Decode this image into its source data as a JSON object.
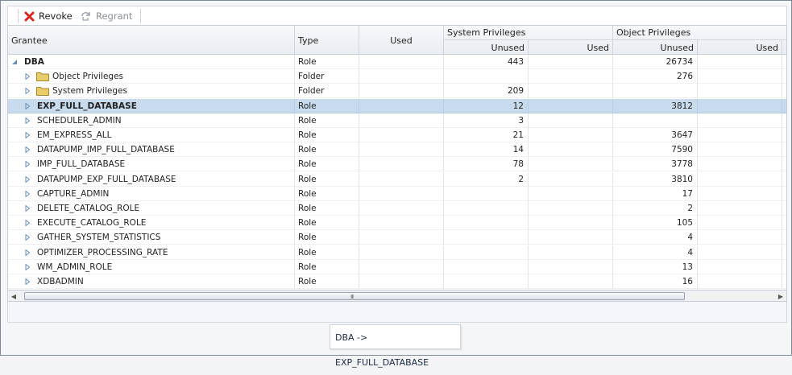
{
  "toolbar": {
    "revoke_label": "Revoke",
    "regrant_label": "Regrant"
  },
  "columns": {
    "grantee": "Grantee",
    "type": "Type",
    "used": "Used",
    "system_privileges": "System Privileges",
    "object_privileges": "Object Privileges",
    "sys_unused": "Unused",
    "sys_used": "Used",
    "obj_unused": "Unused",
    "obj_used": "Used"
  },
  "rows": [
    {
      "grantee": "DBA",
      "type": "Role",
      "used": "",
      "sys_unused": "443",
      "sys_used": "",
      "obj_unused": "26734",
      "obj_used": "",
      "level": 0,
      "expanded": true,
      "bold": true
    },
    {
      "grantee": "Object Privileges",
      "type": "Folder",
      "used": "",
      "sys_unused": "",
      "sys_used": "",
      "obj_unused": "276",
      "obj_used": "",
      "level": 1,
      "folder": true
    },
    {
      "grantee": "System Privileges",
      "type": "Folder",
      "used": "",
      "sys_unused": "209",
      "sys_used": "",
      "obj_unused": "",
      "obj_used": "",
      "level": 1,
      "folder": true
    },
    {
      "grantee": "EXP_FULL_DATABASE",
      "type": "Role",
      "used": "",
      "sys_unused": "12",
      "sys_used": "",
      "obj_unused": "3812",
      "obj_used": "",
      "level": 1,
      "selected": true,
      "bold": true
    },
    {
      "grantee": "SCHEDULER_ADMIN",
      "type": "Role",
      "used": "",
      "sys_unused": "3",
      "sys_used": "",
      "obj_unused": "",
      "obj_used": "",
      "level": 1
    },
    {
      "grantee": "EM_EXPRESS_ALL",
      "type": "Role",
      "used": "",
      "sys_unused": "21",
      "sys_used": "",
      "obj_unused": "3647",
      "obj_used": "",
      "level": 1
    },
    {
      "grantee": "DATAPUMP_IMP_FULL_DATABASE",
      "type": "Role",
      "used": "",
      "sys_unused": "14",
      "sys_used": "",
      "obj_unused": "7590",
      "obj_used": "",
      "level": 1
    },
    {
      "grantee": "IMP_FULL_DATABASE",
      "type": "Role",
      "used": "",
      "sys_unused": "78",
      "sys_used": "",
      "obj_unused": "3778",
      "obj_used": "",
      "level": 1
    },
    {
      "grantee": "DATAPUMP_EXP_FULL_DATABASE",
      "type": "Role",
      "used": "",
      "sys_unused": "2",
      "sys_used": "",
      "obj_unused": "3810",
      "obj_used": "",
      "level": 1
    },
    {
      "grantee": "CAPTURE_ADMIN",
      "type": "Role",
      "used": "",
      "sys_unused": "",
      "sys_used": "",
      "obj_unused": "17",
      "obj_used": "",
      "level": 1
    },
    {
      "grantee": "DELETE_CATALOG_ROLE",
      "type": "Role",
      "used": "",
      "sys_unused": "",
      "sys_used": "",
      "obj_unused": "2",
      "obj_used": "",
      "level": 1
    },
    {
      "grantee": "EXECUTE_CATALOG_ROLE",
      "type": "Role",
      "used": "",
      "sys_unused": "",
      "sys_used": "",
      "obj_unused": "105",
      "obj_used": "",
      "level": 1
    },
    {
      "grantee": "GATHER_SYSTEM_STATISTICS",
      "type": "Role",
      "used": "",
      "sys_unused": "",
      "sys_used": "",
      "obj_unused": "4",
      "obj_used": "",
      "level": 1
    },
    {
      "grantee": "OPTIMIZER_PROCESSING_RATE",
      "type": "Role",
      "used": "",
      "sys_unused": "",
      "sys_used": "",
      "obj_unused": "4",
      "obj_used": "",
      "level": 1
    },
    {
      "grantee": "WM_ADMIN_ROLE",
      "type": "Role",
      "used": "",
      "sys_unused": "",
      "sys_used": "",
      "obj_unused": "13",
      "obj_used": "",
      "level": 1
    },
    {
      "grantee": "XDBADMIN",
      "type": "Role",
      "used": "",
      "sys_unused": "",
      "sys_used": "",
      "obj_unused": "16",
      "obj_used": "",
      "level": 1
    }
  ],
  "scrollbar": {
    "grip": "III"
  },
  "breadcrumb": "DBA -> EXP_FULL_DATABASE",
  "colors": {
    "selected_row": "#c7dbed",
    "revoke_icon": "#d42a1e",
    "folder_icon": "#e8cd6a",
    "twisty": "#6b8fb8"
  }
}
